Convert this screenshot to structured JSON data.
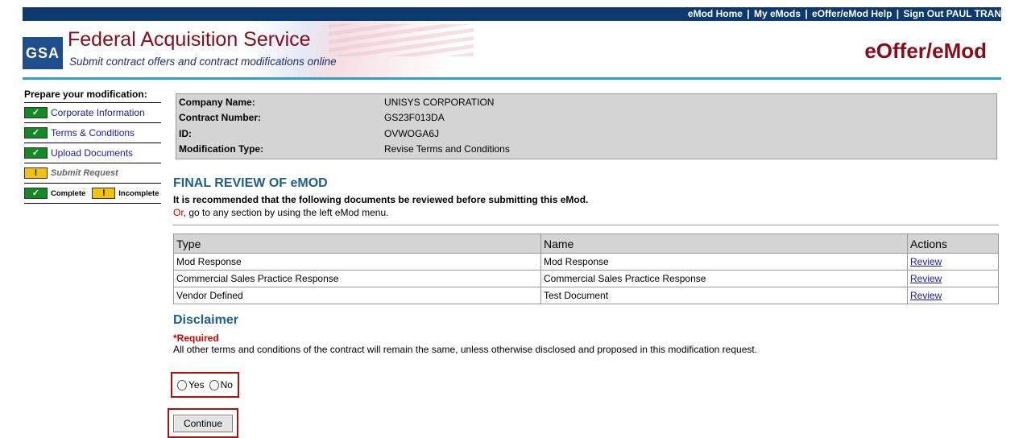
{
  "topnav": {
    "home": "eMod Home",
    "my_emods": "My eMods",
    "help": "eOffer/eMod Help",
    "signout": "Sign Out PAUL TRAN",
    "separator": "|"
  },
  "header": {
    "logo_text": "GSA",
    "title": "Federal Acquisition Service",
    "subtitle": "Submit contract offers and contract modifications online",
    "app_name": "eOffer/eMod"
  },
  "sidebar": {
    "title": "Prepare your modification:",
    "items": [
      {
        "label": "Corporate Information",
        "status": "complete"
      },
      {
        "label": "Terms & Conditions",
        "status": "complete"
      },
      {
        "label": "Upload Documents",
        "status": "complete"
      },
      {
        "label": "Submit Request",
        "status": "incomplete"
      }
    ],
    "legend": {
      "complete": "Complete",
      "incomplete": "Incomplete"
    },
    "check_glyph": "✓",
    "warn_glyph": "!"
  },
  "company": {
    "labels": {
      "name": "Company Name:",
      "contract": "Contract Number:",
      "id": "ID:",
      "mod_type": "Modification Type:"
    },
    "values": {
      "name": "UNISYS CORPORATION",
      "contract": "GS23F013DA",
      "id": "OVWOGA6J",
      "mod_type": "Revise Terms and Conditions"
    }
  },
  "review": {
    "title": "FINAL REVIEW OF eMOD",
    "note": "It is recommended that the following documents be reviewed before submitting this eMod.",
    "or_word": "Or",
    "or_rest": ", go to any section by using the left eMod menu."
  },
  "documents": {
    "headers": [
      "Type",
      "Name",
      "Actions"
    ],
    "rows": [
      {
        "type": "Mod Response",
        "name": "Mod Response",
        "action": "Review"
      },
      {
        "type": "Commercial Sales Practice Response",
        "name": "Commercial Sales Practice Response",
        "action": "Review"
      },
      {
        "type": "Vendor Defined",
        "name": "Test Document",
        "action": "Review"
      }
    ]
  },
  "disclaimer": {
    "title": "Disclaimer",
    "required": "*Required",
    "text": "All other terms and conditions of the contract will remain the same, unless otherwise disclosed and proposed in this modification request.",
    "yes": "Yes",
    "no": "No"
  },
  "actions": {
    "continue": "Continue"
  },
  "colors": {
    "nav_bg": "#0d3a6e",
    "brand_red": "#8b0a1a",
    "accent_blue": "#1e5e8c",
    "complete_green": "#118a21",
    "incomplete_yellow": "#f2c20c",
    "highlight_red": "#b01010"
  }
}
